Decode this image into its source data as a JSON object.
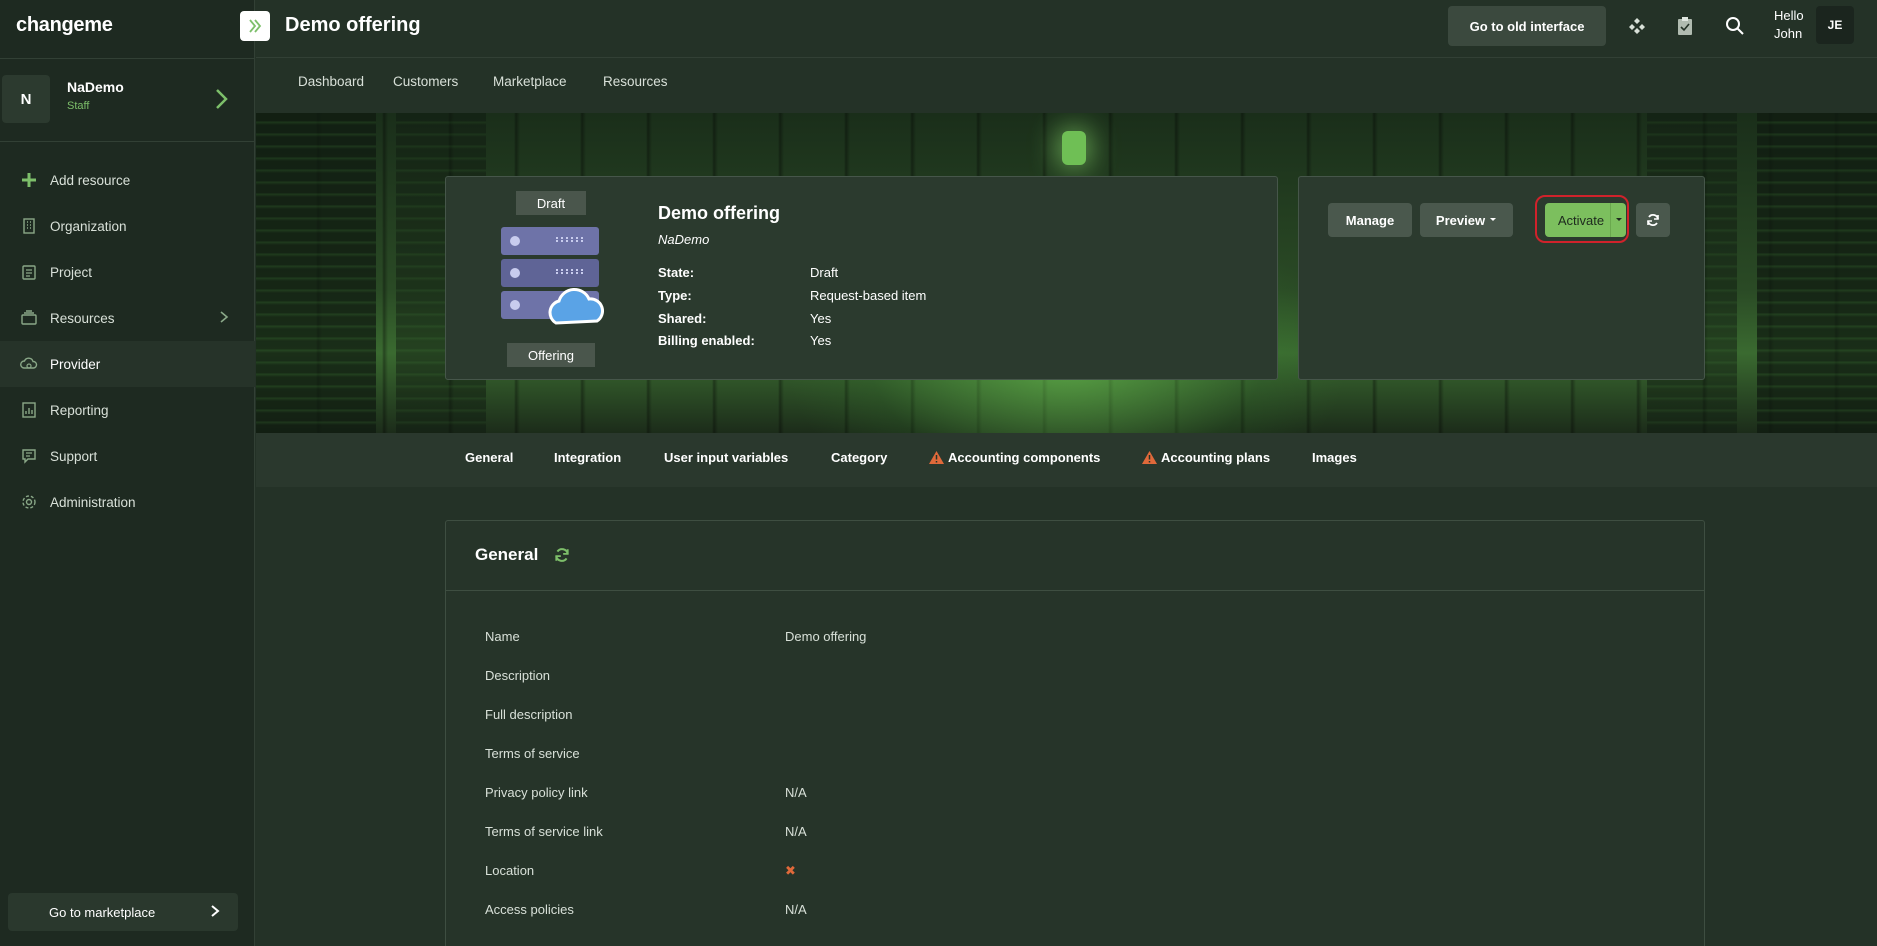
{
  "app": {
    "brand": "changeme",
    "page_title": "Demo offering",
    "old_interface_label": "Go to old interface",
    "hello_label": "Hello",
    "user_name": "John",
    "user_initials": "JE"
  },
  "org": {
    "initial": "N",
    "name": "NaDemo",
    "role": "Staff"
  },
  "sidebar": {
    "items": [
      {
        "label": "Add resource",
        "icon": "plus-icon"
      },
      {
        "label": "Organization",
        "icon": "building-icon"
      },
      {
        "label": "Project",
        "icon": "clipboard-icon"
      },
      {
        "label": "Resources",
        "icon": "stack-icon"
      },
      {
        "label": "Provider",
        "icon": "cloud-gear-icon"
      },
      {
        "label": "Reporting",
        "icon": "chart-icon"
      },
      {
        "label": "Support",
        "icon": "chat-icon"
      },
      {
        "label": "Administration",
        "icon": "gear-icon"
      }
    ],
    "marketplace_label": "Go to marketplace"
  },
  "subnav": {
    "items": [
      "Dashboard",
      "Customers",
      "Marketplace",
      "Resources"
    ]
  },
  "offering": {
    "draft_badge": "Draft",
    "offering_badge": "Offering",
    "title": "Demo offering",
    "org": "NaDemo",
    "props": [
      {
        "key": "State:",
        "value": "Draft"
      },
      {
        "key": "Type:",
        "value": "Request-based item"
      },
      {
        "key": "Shared:",
        "value": "Yes"
      },
      {
        "key": "Billing enabled:",
        "value": "Yes"
      }
    ]
  },
  "actions": {
    "manage": "Manage",
    "preview": "Preview",
    "activate": "Activate"
  },
  "tabs": [
    {
      "label": "General",
      "warning": false
    },
    {
      "label": "Integration",
      "warning": false
    },
    {
      "label": "User input variables",
      "warning": false
    },
    {
      "label": "Category",
      "warning": false
    },
    {
      "label": "Accounting components",
      "warning": true
    },
    {
      "label": "Accounting plans",
      "warning": true
    },
    {
      "label": "Images",
      "warning": false
    }
  ],
  "general": {
    "title": "General",
    "rows": [
      {
        "key": "Name",
        "value": "Demo offering"
      },
      {
        "key": "Description",
        "value": ""
      },
      {
        "key": "Full description",
        "value": ""
      },
      {
        "key": "Terms of service",
        "value": ""
      },
      {
        "key": "Privacy policy link",
        "value": "N/A"
      },
      {
        "key": "Terms of service link",
        "value": "N/A"
      },
      {
        "key": "Location",
        "value": "✖"
      },
      {
        "key": "Access policies",
        "value": "N/A"
      }
    ]
  },
  "colors": {
    "accent": "#7cbf5e",
    "warning": "#e0693a",
    "highlight_ring": "#d0222b"
  }
}
